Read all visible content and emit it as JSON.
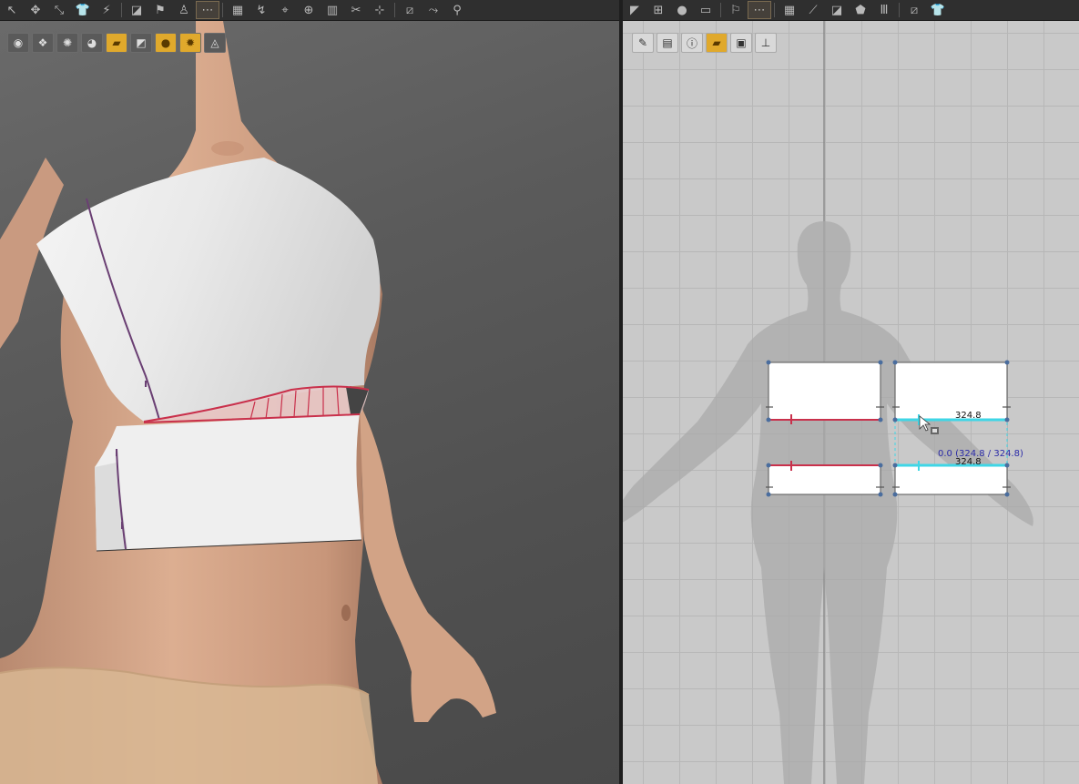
{
  "toolbar3d": {
    "tools": [
      "select-icon",
      "move-icon",
      "transform-icon",
      "garment-icon",
      "magic-wand-icon",
      "fold-icon",
      "flag-icon",
      "avatar-icon",
      "segment-icon",
      "grid-icon",
      "tack-icon",
      "pin-icon",
      "pin-target-icon",
      "zipper-icon",
      "trim-icon",
      "measure-icon",
      "tape-icon",
      "pose-icon",
      "walk-icon"
    ],
    "active_index": 8
  },
  "subtools3d": [
    "avatar-display-icon",
    "texture-icon",
    "pin-tool-icon",
    "avatar-eye-icon",
    "garment-color-icon",
    "mesh-icon",
    "avatar-skin-icon",
    "show-avatar-icon",
    "basket-icon"
  ],
  "toolbar2d": {
    "tools": [
      "edit-pattern-icon",
      "transform-pattern-icon",
      "point-icon",
      "rectangle-icon",
      "dart-icon",
      "segment-sewing-icon",
      "grid-icon",
      "internal-line-icon",
      "fold-icon",
      "trace-icon",
      "pleat-icon",
      "tape-icon",
      "shirt-icon"
    ],
    "active_index": 5
  },
  "subtools2d": [
    "brush-icon",
    "pattern-icon",
    "info-icon",
    "show-pattern-icon",
    "shirt-display-icon",
    "ruler-icon"
  ],
  "measurements": {
    "upper_seam": "324.8",
    "lower_seam": "324.8",
    "ratio": "0.0 (324.8 / 324.8)"
  },
  "colors": {
    "seam_line": "#c9304b",
    "active_seam": "#3fd6e6",
    "skin": "#d9a98a",
    "garment": "#f2f2f2"
  }
}
